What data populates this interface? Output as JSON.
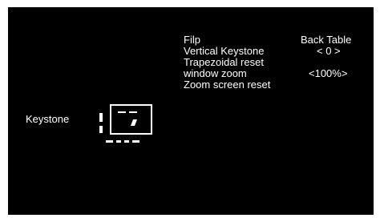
{
  "category": {
    "label": "Keystone",
    "icon": "keystone-trapezoid-icon"
  },
  "menu": {
    "items": [
      {
        "label": "Filp",
        "value": "Back Table"
      },
      {
        "label": "Vertical Keystone",
        "value": "< 0 >"
      },
      {
        "label": "Trapezoidal reset",
        "value": ""
      },
      {
        "label": "window zoom",
        "value": "<100%>"
      },
      {
        "label": "Zoom screen reset",
        "value": ""
      }
    ]
  },
  "colors": {
    "background": "#000000",
    "text": "#ffffff"
  }
}
